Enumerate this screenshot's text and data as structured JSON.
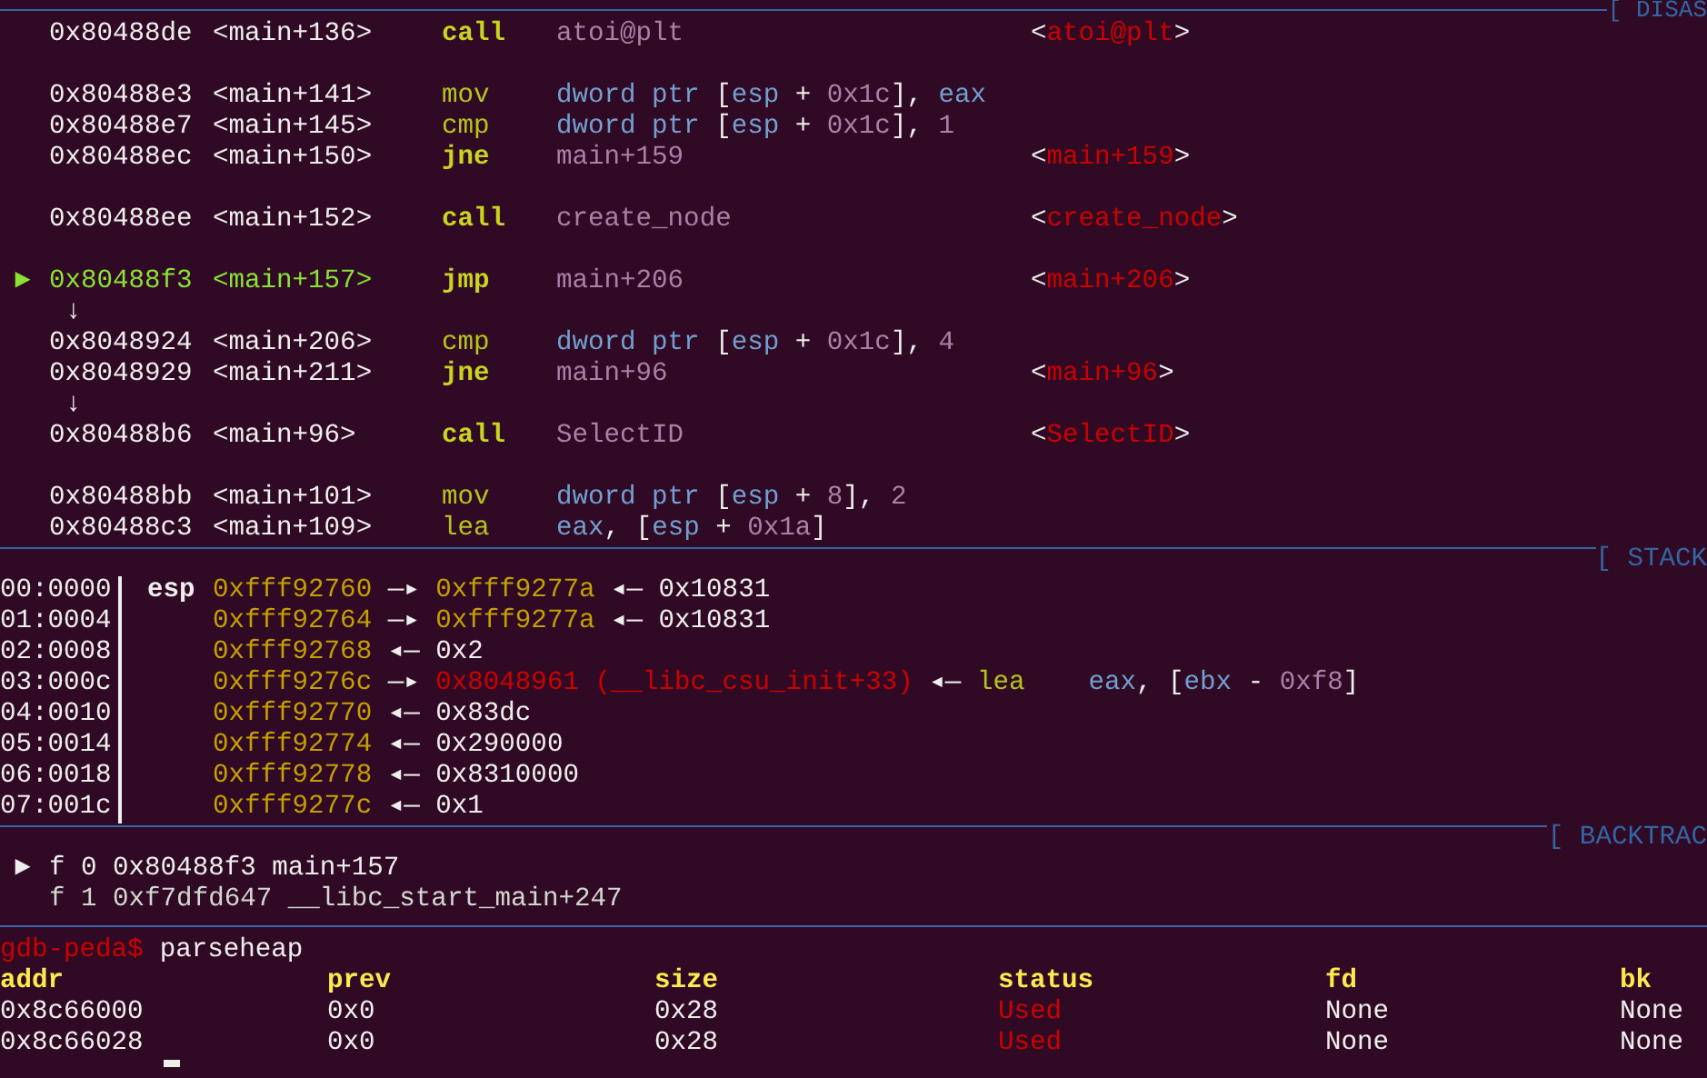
{
  "disasm": {
    "title": "[ DISAS",
    "lines": [
      {
        "kind": "instr",
        "current": false,
        "address": "0x80488de",
        "symbol": "<main+136>",
        "mnemonic": "call",
        "bold": true,
        "operands": [
          {
            "text": "atoi@plt",
            "color": "#ad7fa8"
          }
        ],
        "comment": [
          {
            "text": "<",
            "color": "#eeeeec"
          },
          {
            "text": "atoi@plt",
            "color": "#cc0000"
          },
          {
            "text": ">",
            "color": "#eeeeec"
          }
        ]
      },
      {
        "kind": "blank"
      },
      {
        "kind": "instr",
        "current": false,
        "address": "0x80488e3",
        "symbol": "<main+141>",
        "mnemonic": "mov",
        "bold": false,
        "operands": [
          {
            "text": "dword ptr",
            "color": "#729fcf"
          },
          {
            "text": " [",
            "color": "#eeeeec"
          },
          {
            "text": "esp",
            "color": "#729fcf"
          },
          {
            "text": " + ",
            "color": "#eeeeec"
          },
          {
            "text": "0x1c",
            "color": "#ad7fa8"
          },
          {
            "text": "], ",
            "color": "#eeeeec"
          },
          {
            "text": "eax",
            "color": "#729fcf"
          }
        ]
      },
      {
        "kind": "instr",
        "current": false,
        "address": "0x80488e7",
        "symbol": "<main+145>",
        "mnemonic": "cmp",
        "bold": false,
        "operands": [
          {
            "text": "dword ptr",
            "color": "#729fcf"
          },
          {
            "text": " [",
            "color": "#eeeeec"
          },
          {
            "text": "esp",
            "color": "#729fcf"
          },
          {
            "text": " + ",
            "color": "#eeeeec"
          },
          {
            "text": "0x1c",
            "color": "#ad7fa8"
          },
          {
            "text": "], ",
            "color": "#eeeeec"
          },
          {
            "text": "1",
            "color": "#ad7fa8"
          }
        ]
      },
      {
        "kind": "instr",
        "current": false,
        "address": "0x80488ec",
        "symbol": "<main+150>",
        "mnemonic": "jne",
        "bold": true,
        "operands": [
          {
            "text": "main+159",
            "color": "#ad7fa8"
          }
        ],
        "comment": [
          {
            "text": "<",
            "color": "#eeeeec"
          },
          {
            "text": "main+159",
            "color": "#cc0000"
          },
          {
            "text": ">",
            "color": "#eeeeec"
          }
        ]
      },
      {
        "kind": "blank"
      },
      {
        "kind": "instr",
        "current": false,
        "address": "0x80488ee",
        "symbol": "<main+152>",
        "mnemonic": "call",
        "bold": true,
        "operands": [
          {
            "text": "create_node",
            "color": "#ad7fa8"
          }
        ],
        "comment": [
          {
            "text": "<",
            "color": "#eeeeec"
          },
          {
            "text": "create_node",
            "color": "#cc0000"
          },
          {
            "text": ">",
            "color": "#eeeeec"
          }
        ]
      },
      {
        "kind": "blank"
      },
      {
        "kind": "instr",
        "current": true,
        "marker": "►",
        "address": "0x80488f3",
        "symbol": "<main+157>",
        "mnemonic": "jmp",
        "bold": true,
        "operands": [
          {
            "text": "main+206",
            "color": "#ad7fa8"
          }
        ],
        "comment": [
          {
            "text": "<",
            "color": "#eeeeec"
          },
          {
            "text": "main+206",
            "color": "#cc0000"
          },
          {
            "text": ">",
            "color": "#eeeeec"
          }
        ]
      },
      {
        "kind": "arrow",
        "text": "↓"
      },
      {
        "kind": "instr",
        "current": false,
        "address": "0x8048924",
        "symbol": "<main+206>",
        "mnemonic": "cmp",
        "bold": false,
        "operands": [
          {
            "text": "dword ptr",
            "color": "#729fcf"
          },
          {
            "text": " [",
            "color": "#eeeeec"
          },
          {
            "text": "esp",
            "color": "#729fcf"
          },
          {
            "text": " + ",
            "color": "#eeeeec"
          },
          {
            "text": "0x1c",
            "color": "#ad7fa8"
          },
          {
            "text": "], ",
            "color": "#eeeeec"
          },
          {
            "text": "4",
            "color": "#ad7fa8"
          }
        ]
      },
      {
        "kind": "instr",
        "current": false,
        "address": "0x8048929",
        "symbol": "<main+211>",
        "mnemonic": "jne",
        "bold": true,
        "operands": [
          {
            "text": "main+96",
            "color": "#ad7fa8"
          }
        ],
        "comment": [
          {
            "text": "<",
            "color": "#eeeeec"
          },
          {
            "text": "main+96",
            "color": "#cc0000"
          },
          {
            "text": ">",
            "color": "#eeeeec"
          }
        ]
      },
      {
        "kind": "arrow",
        "text": "↓"
      },
      {
        "kind": "instr",
        "current": false,
        "address": "0x80488b6",
        "symbol": "<main+96>",
        "mnemonic": "call",
        "bold": true,
        "operands": [
          {
            "text": "SelectID",
            "color": "#ad7fa8"
          }
        ],
        "comment": [
          {
            "text": "<",
            "color": "#eeeeec"
          },
          {
            "text": "SelectID",
            "color": "#cc0000"
          },
          {
            "text": ">",
            "color": "#eeeeec"
          }
        ]
      },
      {
        "kind": "blank"
      },
      {
        "kind": "instr",
        "current": false,
        "address": "0x80488bb",
        "symbol": "<main+101>",
        "mnemonic": "mov",
        "bold": false,
        "operands": [
          {
            "text": "dword ptr",
            "color": "#729fcf"
          },
          {
            "text": " [",
            "color": "#eeeeec"
          },
          {
            "text": "esp",
            "color": "#729fcf"
          },
          {
            "text": " + ",
            "color": "#eeeeec"
          },
          {
            "text": "8",
            "color": "#ad7fa8"
          },
          {
            "text": "], ",
            "color": "#eeeeec"
          },
          {
            "text": "2",
            "color": "#ad7fa8"
          }
        ]
      },
      {
        "kind": "instr",
        "current": false,
        "address": "0x80488c3",
        "symbol": "<main+109>",
        "mnemonic": "lea",
        "bold": false,
        "operands": [
          {
            "text": "eax",
            "color": "#729fcf"
          },
          {
            "text": ", [",
            "color": "#eeeeec"
          },
          {
            "text": "esp",
            "color": "#729fcf"
          },
          {
            "text": " + ",
            "color": "#eeeeec"
          },
          {
            "text": "0x1a",
            "color": "#ad7fa8"
          },
          {
            "text": "]",
            "color": "#eeeeec"
          }
        ]
      }
    ]
  },
  "stack": {
    "title": "[ STACK",
    "rows": [
      {
        "index": "00:0000",
        "register": "esp",
        "chain": [
          {
            "text": "0xfff92760",
            "color": "#c4a000"
          },
          {
            "text": " —▸ ",
            "color": "#eeeeec"
          },
          {
            "text": "0xfff9277a",
            "color": "#c4a000"
          },
          {
            "text": " ◂— ",
            "color": "#eeeeec"
          },
          {
            "text": "0x10831",
            "color": "#eeeeec"
          }
        ]
      },
      {
        "index": "01:0004",
        "chain": [
          {
            "text": "0xfff92764",
            "color": "#c4a000"
          },
          {
            "text": " —▸ ",
            "color": "#eeeeec"
          },
          {
            "text": "0xfff9277a",
            "color": "#c4a000"
          },
          {
            "text": " ◂— ",
            "color": "#eeeeec"
          },
          {
            "text": "0x10831",
            "color": "#eeeeec"
          }
        ]
      },
      {
        "index": "02:0008",
        "chain": [
          {
            "text": "0xfff92768",
            "color": "#c4a000"
          },
          {
            "text": " ◂— ",
            "color": "#eeeeec"
          },
          {
            "text": "0x2",
            "color": "#eeeeec"
          }
        ]
      },
      {
        "index": "03:000c",
        "chain": [
          {
            "text": "0xfff9276c",
            "color": "#c4a000"
          },
          {
            "text": " —▸ ",
            "color": "#eeeeec"
          },
          {
            "text": "0x8048961 (__libc_csu_init+33)",
            "color": "#cc0000"
          },
          {
            "text": " ◂— ",
            "color": "#eeeeec"
          },
          {
            "text": "lea",
            "color": "#b5c41c",
            "kind": "mnemonic"
          },
          {
            "text": "eax",
            "color": "#729fcf"
          },
          {
            "text": ", [",
            "color": "#eeeeec"
          },
          {
            "text": "ebx",
            "color": "#729fcf"
          },
          {
            "text": " - ",
            "color": "#eeeeec"
          },
          {
            "text": "0xf8",
            "color": "#ad7fa8"
          },
          {
            "text": "]",
            "color": "#eeeeec"
          }
        ]
      },
      {
        "index": "04:0010",
        "chain": [
          {
            "text": "0xfff92770",
            "color": "#c4a000"
          },
          {
            "text": " ◂— ",
            "color": "#eeeeec"
          },
          {
            "text": "0x83dc",
            "color": "#eeeeec"
          }
        ]
      },
      {
        "index": "05:0014",
        "chain": [
          {
            "text": "0xfff92774",
            "color": "#c4a000"
          },
          {
            "text": " ◂— ",
            "color": "#eeeeec"
          },
          {
            "text": "0x290000",
            "color": "#eeeeec"
          }
        ]
      },
      {
        "index": "06:0018",
        "chain": [
          {
            "text": "0xfff92778",
            "color": "#c4a000"
          },
          {
            "text": " ◂— ",
            "color": "#eeeeec"
          },
          {
            "text": "0x8310000",
            "color": "#eeeeec"
          }
        ]
      },
      {
        "index": "07:001c",
        "chain": [
          {
            "text": "0xfff9277c",
            "color": "#c4a000"
          },
          {
            "text": " ◂— ",
            "color": "#eeeeec"
          },
          {
            "text": "0x1",
            "color": "#eeeeec"
          }
        ]
      }
    ]
  },
  "backtrace": {
    "title": "[ BACKTRAC",
    "frames": [
      {
        "selected": true,
        "marker": "►",
        "text": "f 0 0x80488f3 main+157"
      },
      {
        "selected": false,
        "text": "f 1 0xf7dfd647 __libc_start_main+247"
      }
    ]
  },
  "console": {
    "prompt": "gdb-peda$",
    "command": "parseheap",
    "columns": [
      {
        "label": "addr"
      },
      {
        "label": "prev"
      },
      {
        "label": "size"
      },
      {
        "label": "status"
      },
      {
        "label": "fd"
      },
      {
        "label": "bk"
      }
    ],
    "rows": [
      [
        "0x8c66000",
        "0x0",
        "0x28",
        {
          "text": "Used",
          "color": "#cc0000"
        },
        "None",
        "None"
      ],
      [
        "0x8c66028",
        "0x0",
        "0x28",
        {
          "text": "Used",
          "color": "#cc0000"
        },
        "None",
        "None"
      ]
    ],
    "cursor_visible": true
  }
}
